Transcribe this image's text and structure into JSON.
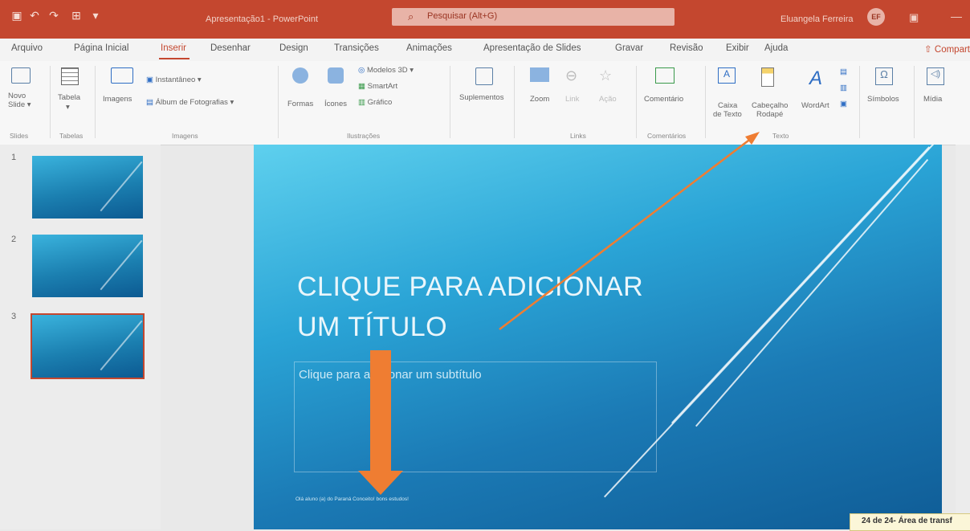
{
  "window": {
    "title": "Apresentação1 - PowerPoint",
    "search_placeholder": "Pesquisar (Alt+G)",
    "user_name": "Eluangela Ferreira",
    "user_initials": "EF"
  },
  "tabs": [
    "Arquivo",
    "Página Inicial",
    "Inserir",
    "Desenhar",
    "Design",
    "Transições",
    "Animações",
    "Apresentação de Slides",
    "Gravar",
    "Revisão",
    "Exibir",
    "Ajuda"
  ],
  "active_tab": "Inserir",
  "share_label": "Compart",
  "ribbon": {
    "novo_slide": [
      "Novo",
      "Slide ▾"
    ],
    "tabela": "Tabela",
    "imagens": "Imagens",
    "instantaneo": "Instantâneo ▾",
    "album": "Álbum de Fotografias ▾",
    "formas": "Formas",
    "icones": "Ícones",
    "modelos3d": "Modelos 3D ▾",
    "smartart": "SmartArt",
    "grafico": "Gráfico",
    "suplementos": "Suplementos",
    "zoom": "Zoom",
    "link": "Link",
    "acao": "Ação",
    "comentario": "Comentário",
    "caixa_texto": [
      "Caixa",
      "de Texto"
    ],
    "cabecalho": [
      "Cabeçalho",
      "Rodapé"
    ],
    "wordart": "WordArt",
    "simbolos": "Símbolos",
    "midia": "Mídia",
    "groups": {
      "slides": "Slides",
      "tabelas": "Tabelas",
      "imagens": "Imagens",
      "ilustracoes": "Ilustrações",
      "links": "Links",
      "comentarios": "Comentários",
      "texto": "Texto"
    }
  },
  "thumbnails": [
    "1",
    "2",
    "3"
  ],
  "selected_slide": 3,
  "slide": {
    "title_line1": "CLIQUE PARA ADICIONAR",
    "title_line2": "UM TÍTULO",
    "subtitle": "Clique para adicionar um subtítulo",
    "footer": "Olá aluno (a) do Paraná Conceito! bons estudos!"
  },
  "status_chip": "24 de 24- Área de transf",
  "colors": {
    "accent": "#c4472f",
    "arrow": "#ef7d32"
  }
}
